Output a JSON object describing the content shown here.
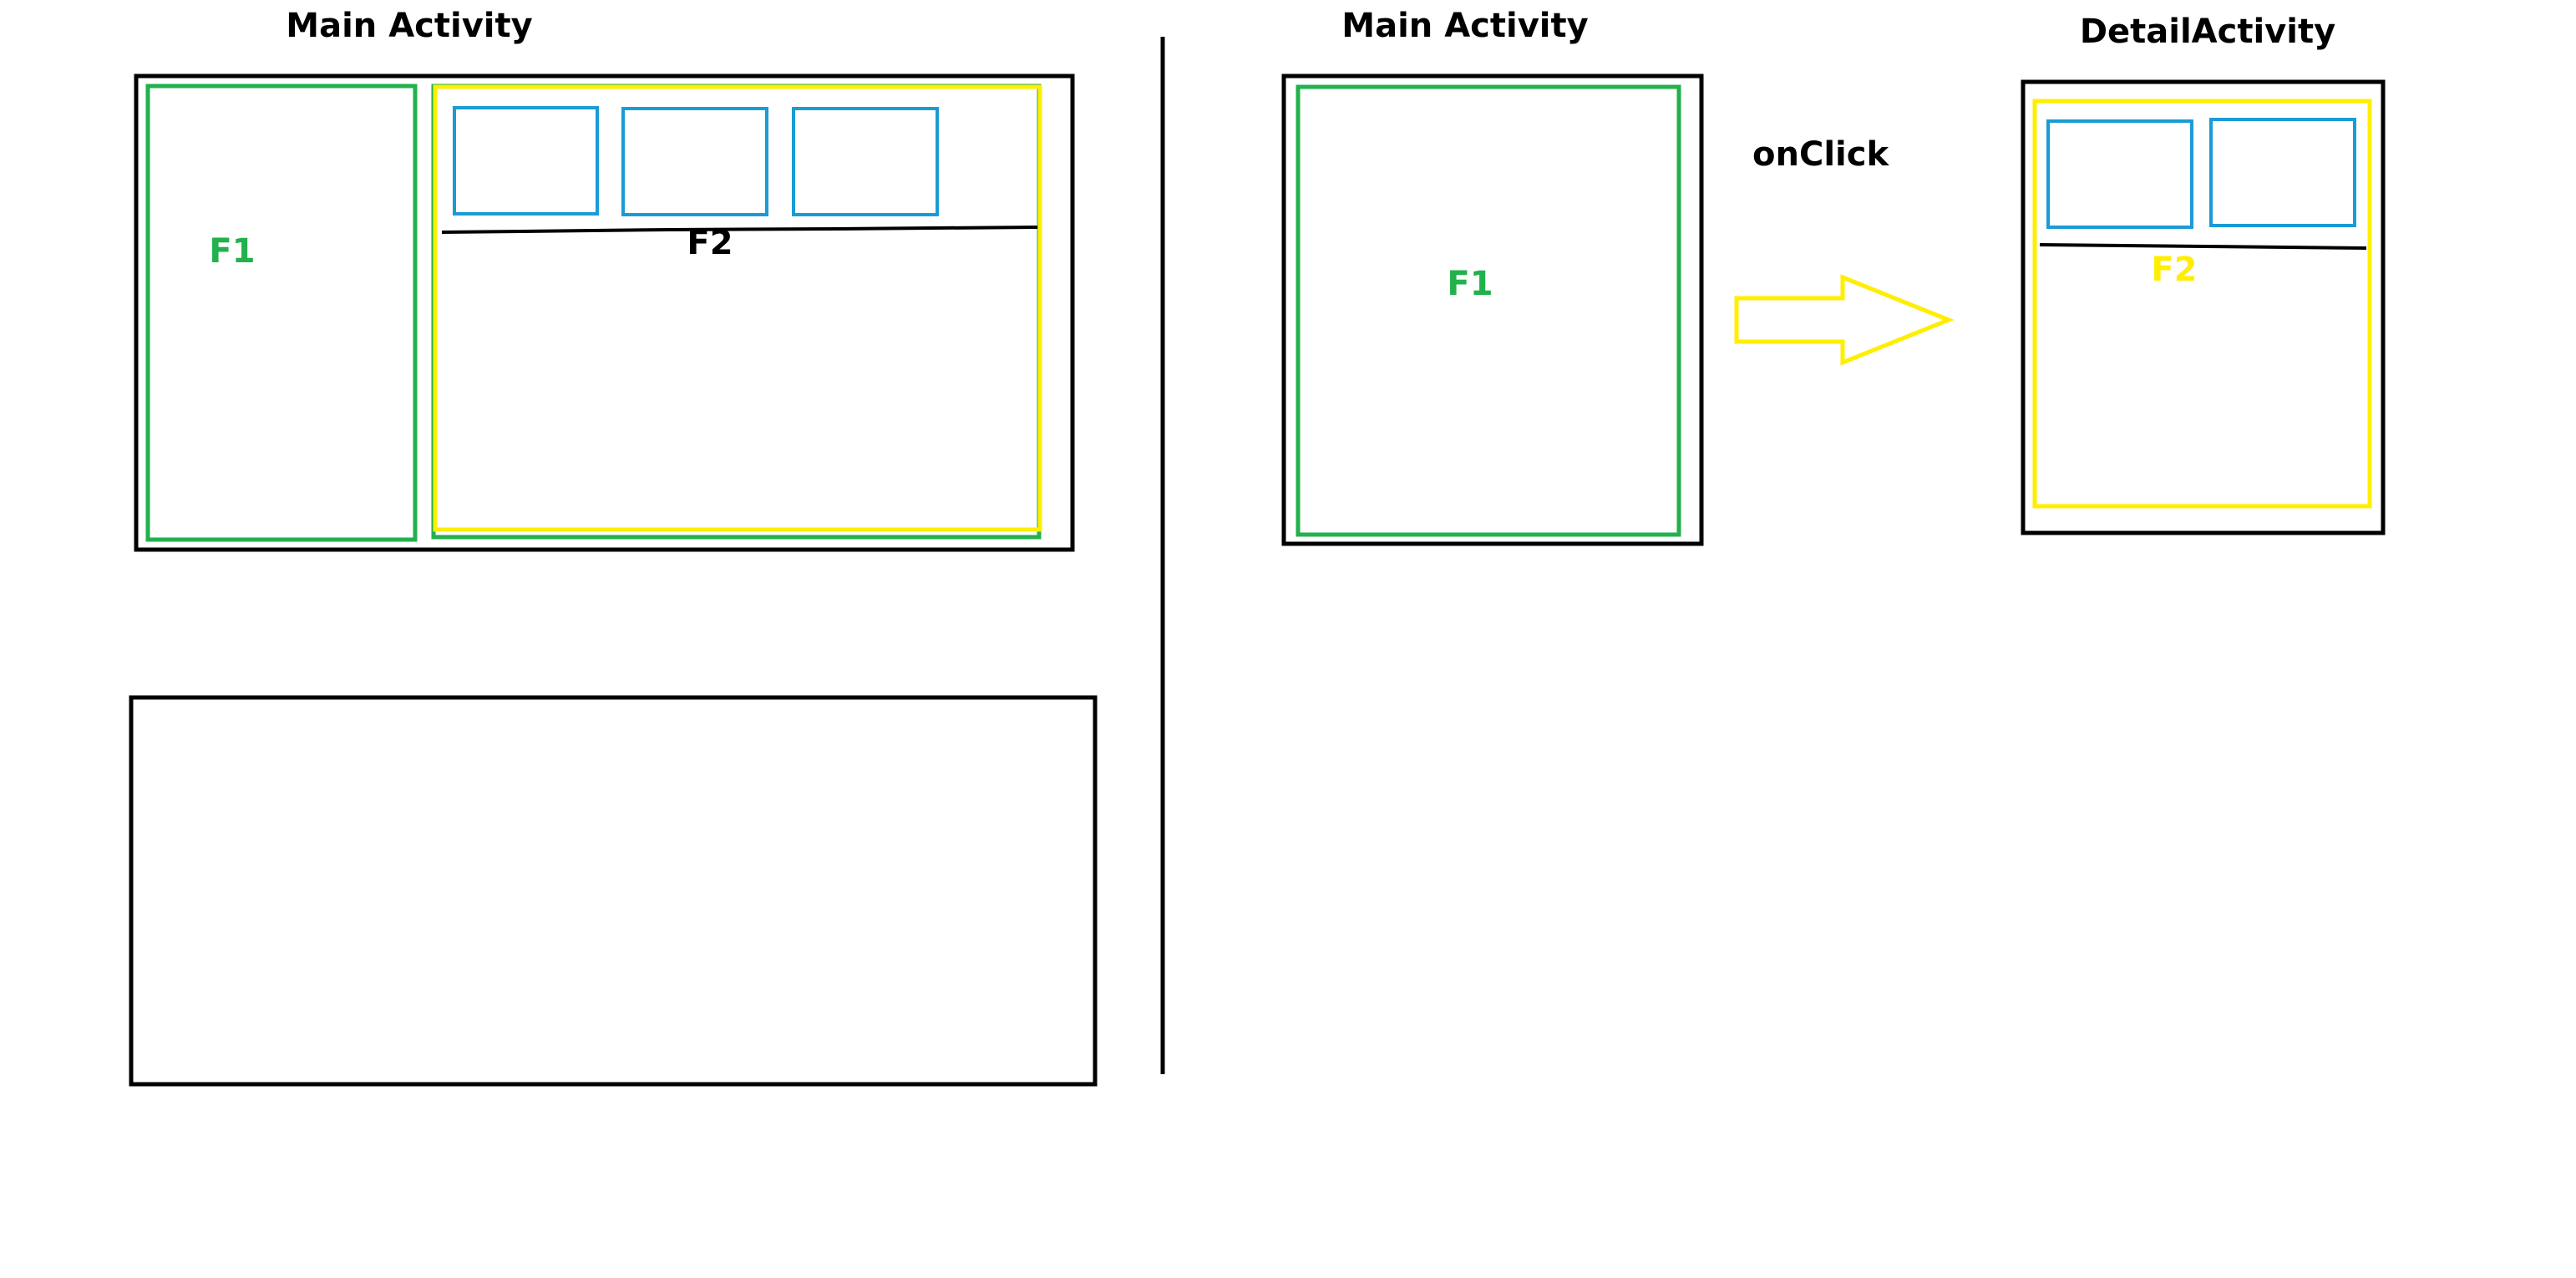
{
  "colors": {
    "black": "#000000",
    "green": "#22b14c",
    "yellow": "#ffee00",
    "blue": "#1a9bd7",
    "background": "#ffffff"
  },
  "tablet_layout": {
    "title": "Main Activity",
    "fragment1_label": "F1",
    "fragment2_label": "F2",
    "fragment2_button_count": 3
  },
  "phone_main": {
    "title": "Main Activity",
    "fragment1_label": "F1"
  },
  "transition": {
    "label": "onClick",
    "arrow_icon": "right-arrow-icon"
  },
  "phone_detail": {
    "title": "DetailActivity",
    "fragment2_label": "F2",
    "fragment2_button_count": 2
  }
}
